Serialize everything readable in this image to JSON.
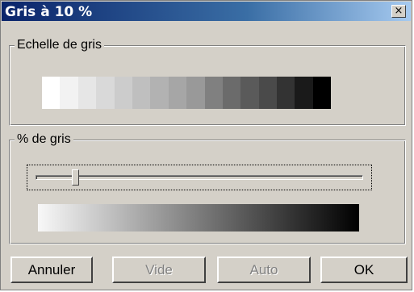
{
  "window": {
    "title": "Gris à 10 %",
    "close_glyph": "×"
  },
  "groups": {
    "scale": {
      "label": "Echelle de gris"
    },
    "percent": {
      "label": "% de gris"
    }
  },
  "grayscale_swatches": [
    "#ffffff",
    "#f2f2f2",
    "#e6e6e6",
    "#d9d9d9",
    "#cccccc",
    "#bfbfbf",
    "#b2b2b2",
    "#a6a6a6",
    "#999999",
    "#808080",
    "#6b6b6b",
    "#5a5a5a",
    "#4a4a4a",
    "#333333",
    "#1a1a1a",
    "#000000"
  ],
  "slider": {
    "value_percent": 10
  },
  "buttons": {
    "cancel": "Annuler",
    "empty": "Vide",
    "auto": "Auto",
    "ok": "OK"
  }
}
